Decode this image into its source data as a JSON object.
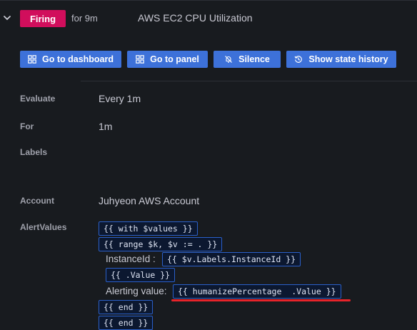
{
  "alert": {
    "state": "Firing",
    "duration": "for 9m",
    "name": "AWS EC2 CPU Utilization"
  },
  "actions": {
    "dashboard": "Go to dashboard",
    "panel": "Go to panel",
    "silence": "Silence",
    "history": "Show state history"
  },
  "details": {
    "evaluate_label": "Evaluate",
    "evaluate_value": "Every 1m",
    "for_label": "For",
    "for_value": "1m",
    "labels_label": "Labels",
    "account_label": "Account",
    "account_value": "Juhyeon AWS Account",
    "alertvalues_label": "AlertValues"
  },
  "template": {
    "with": "{{ with $values }}",
    "range": "{{ range $k, $v := . }}",
    "instance_label": "InstanceId :",
    "instance_tpl": "{{ $v.Labels.InstanceId }}",
    "value_tpl": "{{ .Value }}",
    "alerting_label": "Alerting value:",
    "humanize_tpl": "{{ humanizePercentage  .Value }}",
    "end1": "{{ end }}",
    "end2": "{{ end }}"
  },
  "colors": {
    "firing": "#d10e5c",
    "button": "#3d71d9",
    "highlight": "#e8232a"
  },
  "icons": {
    "expand": "chevron-down-icon",
    "dashboard": "apps-icon",
    "panel": "apps-icon",
    "silence": "bell-slash-icon",
    "history": "history-icon"
  }
}
